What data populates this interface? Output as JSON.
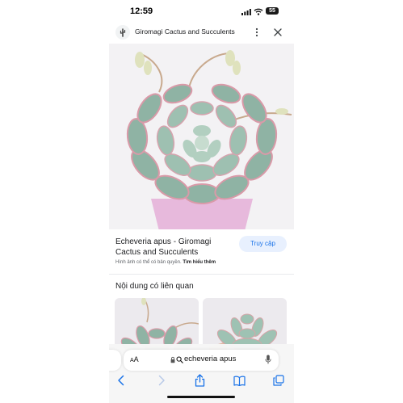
{
  "status_bar": {
    "time": "12:59",
    "battery": "55",
    "icons": [
      "signal-icon",
      "wifi-icon",
      "battery-icon"
    ]
  },
  "header": {
    "site_icon": "cactus-icon",
    "title": "Giromagi Cactus and Succulents",
    "menu_icon": "more-vertical-icon",
    "close_icon": "close-icon"
  },
  "image": {
    "subject": "echeveria-apus-rosette-in-pink-pot"
  },
  "info": {
    "title": "Echeveria apus - Giromagi Cactus and Succulents",
    "visit_label": "Truy cập",
    "copyright_text": "Hình ảnh có thể có bản quyền.",
    "learn_more_label": "Tìm hiểu thêm"
  },
  "related": {
    "heading": "Nội dung có liên quan",
    "items": [
      "related-image-1",
      "related-image-2"
    ]
  },
  "browser": {
    "aa_large": "A",
    "aa_small": "A",
    "address_text": "echeveria apus",
    "icons": [
      "lock-icon",
      "search-icon",
      "mic-icon"
    ],
    "nav_icons": [
      "back-icon",
      "forward-icon",
      "share-icon",
      "bookmarks-icon",
      "tabs-icon"
    ]
  },
  "colors": {
    "accent": "#1a73e8",
    "visit_button_bg": "#e8f0fe",
    "leaf_green": "#8fb3a4",
    "leaf_tip_pink": "#d99aa8",
    "pot_pink": "#e7b9dc"
  }
}
